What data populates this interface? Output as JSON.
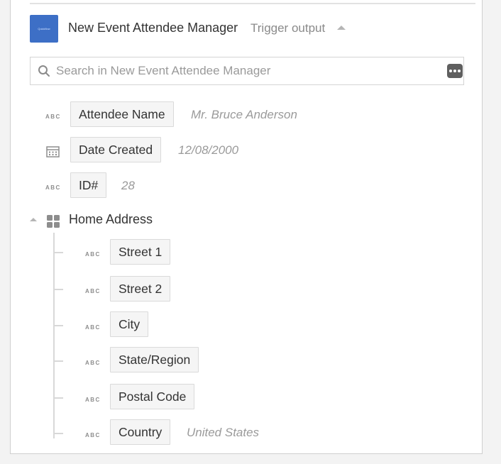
{
  "header": {
    "app_logo_text": "Quickflow",
    "title": "New Event Attendee Manager",
    "subtitle": "Trigger output"
  },
  "search": {
    "placeholder": "Search in New Event Attendee Manager",
    "value": ""
  },
  "fields": [
    {
      "type": "ABC",
      "type_icon": "text-type-icon",
      "label": "Attendee Name",
      "sample": "Mr. Bruce Anderson"
    },
    {
      "type": "date",
      "type_icon": "calendar-icon",
      "label": "Date Created",
      "sample": "12/08/2000"
    },
    {
      "type": "ABC",
      "type_icon": "text-type-icon",
      "label": "ID#",
      "sample": "28"
    }
  ],
  "group": {
    "label": "Home Address",
    "icon": "grid-icon",
    "expanded": true,
    "children": [
      {
        "type": "ABC",
        "label": "Street 1",
        "sample": ""
      },
      {
        "type": "ABC",
        "label": "Street 2",
        "sample": ""
      },
      {
        "type": "ABC",
        "label": "City",
        "sample": ""
      },
      {
        "type": "ABC",
        "label": "State/Region",
        "sample": ""
      },
      {
        "type": "ABC",
        "label": "Postal Code",
        "sample": ""
      },
      {
        "type": "ABC",
        "label": "Country",
        "sample": "United States"
      }
    ]
  },
  "colors": {
    "app_logo": "#3d6fc6",
    "pill_bg": "#f5f5f5",
    "pill_border": "#dadada",
    "sample_text": "#9a9a9a"
  }
}
